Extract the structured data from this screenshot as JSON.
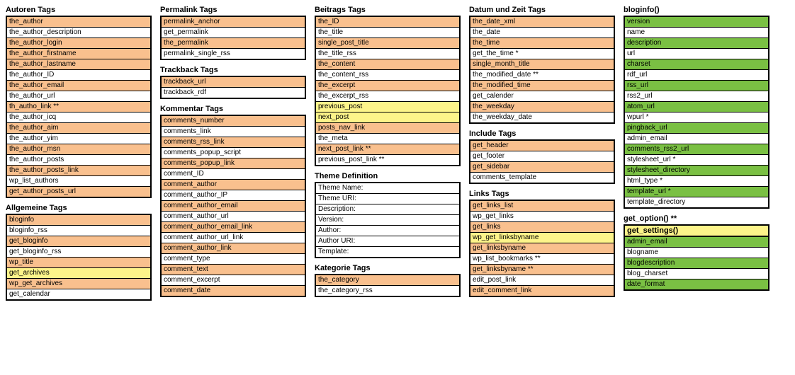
{
  "col1": {
    "autoren": {
      "title": "Autoren Tags",
      "rows": [
        {
          "t": "the_author",
          "c": "orange"
        },
        {
          "t": "the_author_description",
          "c": "white"
        },
        {
          "t": "the_author_login",
          "c": "orange"
        },
        {
          "t": "the_author_firstname",
          "c": "orange"
        },
        {
          "t": "the_author_lastname",
          "c": "orange"
        },
        {
          "t": "the_author_ID",
          "c": "white"
        },
        {
          "t": "the_author_email",
          "c": "orange"
        },
        {
          "t": "the_author_url",
          "c": "white"
        },
        {
          "t": "th_autho_link **",
          "c": "orange"
        },
        {
          "t": "the_author_icq",
          "c": "white"
        },
        {
          "t": "the_author_aim",
          "c": "orange"
        },
        {
          "t": "the_author_yim",
          "c": "white"
        },
        {
          "t": "the_author_msn",
          "c": "orange"
        },
        {
          "t": "the_author_posts",
          "c": "white"
        },
        {
          "t": "the_author_posts_link",
          "c": "orange"
        },
        {
          "t": "wp_list_authors",
          "c": "white"
        },
        {
          "t": "get_author_posts_url",
          "c": "orange"
        }
      ]
    },
    "allgemeine": {
      "title": "Allgemeine Tags",
      "rows": [
        {
          "t": "bloginfo",
          "c": "orange"
        },
        {
          "t": "bloginfo_rss",
          "c": "white"
        },
        {
          "t": "get_bloginfo",
          "c": "orange"
        },
        {
          "t": "get_bloginfo_rss",
          "c": "white"
        },
        {
          "t": "wp_title",
          "c": "orange"
        },
        {
          "t": "get_archives",
          "c": "yellow"
        },
        {
          "t": "wp_get_archives",
          "c": "orange"
        },
        {
          "t": "get_calendar",
          "c": "white"
        }
      ]
    }
  },
  "col2": {
    "permalink": {
      "title": "Permalink Tags",
      "rows": [
        {
          "t": "permalink_anchor",
          "c": "orange"
        },
        {
          "t": "get_permalink",
          "c": "white"
        },
        {
          "t": "the_permalink",
          "c": "orange"
        },
        {
          "t": "permalink_single_rss",
          "c": "white"
        }
      ]
    },
    "trackback": {
      "title": "Trackback Tags",
      "rows": [
        {
          "t": "trackback_url",
          "c": "orange"
        },
        {
          "t": "trackback_rdf",
          "c": "white"
        }
      ]
    },
    "kommentar": {
      "title": "Kommentar Tags",
      "rows": [
        {
          "t": "comments_number",
          "c": "orange"
        },
        {
          "t": "comments_link",
          "c": "white"
        },
        {
          "t": "comments_rss_link",
          "c": "orange"
        },
        {
          "t": "comments_popup_script",
          "c": "white"
        },
        {
          "t": "comments_popup_link",
          "c": "orange"
        },
        {
          "t": "comment_ID",
          "c": "white"
        },
        {
          "t": "comment_author",
          "c": "orange"
        },
        {
          "t": "comment_author_IP",
          "c": "white"
        },
        {
          "t": "comment_author_email",
          "c": "orange"
        },
        {
          "t": "comment_author_url",
          "c": "white"
        },
        {
          "t": "comment_author_email_link",
          "c": "orange"
        },
        {
          "t": "comment_author_url_link",
          "c": "white"
        },
        {
          "t": "comment_author_link",
          "c": "orange"
        },
        {
          "t": "comment_type",
          "c": "white"
        },
        {
          "t": "comment_text",
          "c": "orange"
        },
        {
          "t": "comment_excerpt",
          "c": "white"
        },
        {
          "t": "comment_date",
          "c": "orange"
        }
      ]
    }
  },
  "col3": {
    "beitrags": {
      "title": "Beitrags Tags",
      "rows": [
        {
          "t": "the_ID",
          "c": "orange"
        },
        {
          "t": "the_title",
          "c": "white"
        },
        {
          "t": "single_post_title",
          "c": "orange"
        },
        {
          "t": "the_title_rss",
          "c": "white"
        },
        {
          "t": "the_content",
          "c": "orange"
        },
        {
          "t": "the_content_rss",
          "c": "white"
        },
        {
          "t": "the_excerpt",
          "c": "orange"
        },
        {
          "t": "the_excerpt_rss",
          "c": "white"
        },
        {
          "t": "previous_post",
          "c": "yellow"
        },
        {
          "t": "next_post",
          "c": "yellow"
        },
        {
          "t": "posts_nav_link",
          "c": "orange"
        },
        {
          "t": "the_meta",
          "c": "white"
        },
        {
          "t": "next_post_link **",
          "c": "orange"
        },
        {
          "t": "previous_post_link **",
          "c": "white"
        }
      ]
    },
    "theme": {
      "title": "Theme Definition",
      "rows": [
        {
          "t": "Theme Name:",
          "c": "white"
        },
        {
          "t": "Theme URI:",
          "c": "white"
        },
        {
          "t": "Description:",
          "c": "white"
        },
        {
          "t": "Version:",
          "c": "white"
        },
        {
          "t": "Author:",
          "c": "white"
        },
        {
          "t": "Author URI:",
          "c": "white"
        },
        {
          "t": "Template:",
          "c": "white"
        }
      ]
    },
    "kategorie": {
      "title": "Kategorie Tags",
      "rows": [
        {
          "t": "the_category",
          "c": "orange"
        },
        {
          "t": "the_category_rss",
          "c": "white"
        }
      ]
    }
  },
  "col4": {
    "datum": {
      "title": "Datum und Zeit Tags",
      "rows": [
        {
          "t": "the_date_xml",
          "c": "orange"
        },
        {
          "t": "the_date",
          "c": "white"
        },
        {
          "t": "the_time",
          "c": "orange"
        },
        {
          "t": "get_the_time *",
          "c": "white"
        },
        {
          "t": "single_month_title",
          "c": "orange"
        },
        {
          "t": "the_modified_date **",
          "c": "white"
        },
        {
          "t": "the_modified_time",
          "c": "orange"
        },
        {
          "t": "get_calender",
          "c": "white"
        },
        {
          "t": "the_weekday",
          "c": "orange"
        },
        {
          "t": "the_weekday_date",
          "c": "white"
        }
      ]
    },
    "include": {
      "title": "Include Tags",
      "rows": [
        {
          "t": "get_header",
          "c": "orange"
        },
        {
          "t": "get_footer",
          "c": "white"
        },
        {
          "t": "get_sidebar",
          "c": "orange"
        },
        {
          "t": "comments_template",
          "c": "white"
        }
      ]
    },
    "links": {
      "title": "Links Tags",
      "rows": [
        {
          "t": "get_links_list",
          "c": "orange"
        },
        {
          "t": "wp_get_links",
          "c": "white"
        },
        {
          "t": "get_links",
          "c": "orange"
        },
        {
          "t": "wp_get_linksbyname",
          "c": "yellow"
        },
        {
          "t": "get_linksbyname",
          "c": "orange"
        },
        {
          "t": "wp_list_bookmarks **",
          "c": "white"
        },
        {
          "t": "get_linksbyname **",
          "c": "orange"
        },
        {
          "t": "edit_post_link",
          "c": "white"
        },
        {
          "t": "edit_comment_link",
          "c": "orange"
        }
      ]
    }
  },
  "col5": {
    "bloginfo": {
      "title": "bloginfo()",
      "rows": [
        {
          "t": "version",
          "c": "green"
        },
        {
          "t": "name",
          "c": "white"
        },
        {
          "t": "description",
          "c": "green"
        },
        {
          "t": "url",
          "c": "white"
        },
        {
          "t": "charset",
          "c": "green"
        },
        {
          "t": "rdf_url",
          "c": "white"
        },
        {
          "t": "rss_url",
          "c": "green"
        },
        {
          "t": "rss2_url",
          "c": "white"
        },
        {
          "t": "atom_url",
          "c": "green"
        },
        {
          "t": "wpurl *",
          "c": "white"
        },
        {
          "t": "pingback_url",
          "c": "green"
        },
        {
          "t": "admin_email",
          "c": "white"
        },
        {
          "t": "comments_rss2_url",
          "c": "green"
        },
        {
          "t": "stylesheet_url *",
          "c": "white"
        },
        {
          "t": "stylesheet_directory",
          "c": "green"
        },
        {
          "t": "html_type *",
          "c": "white"
        },
        {
          "t": "template_url *",
          "c": "green"
        },
        {
          "t": "template_directory",
          "c": "white"
        }
      ]
    },
    "getoption_title": "get_option() **",
    "getsettings": {
      "title": "get_settings()",
      "rows": [
        {
          "t": "admin_email",
          "c": "green"
        },
        {
          "t": "blogname",
          "c": "white"
        },
        {
          "t": "blogdescription",
          "c": "green"
        },
        {
          "t": "blog_charset",
          "c": "white"
        },
        {
          "t": "date_format",
          "c": "green"
        }
      ]
    }
  }
}
